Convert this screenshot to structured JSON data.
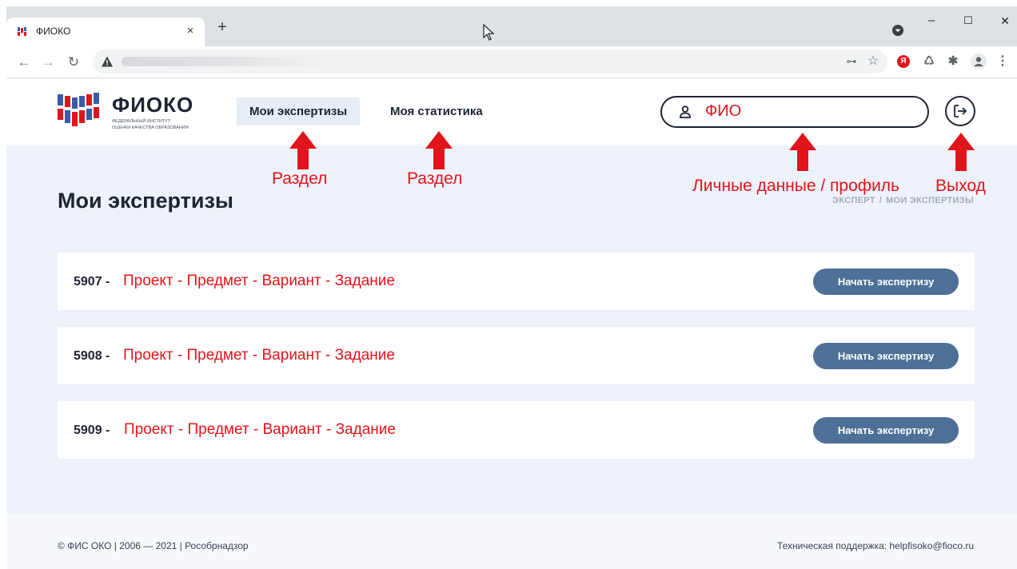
{
  "browser": {
    "tab_title": "ФИОКО",
    "tab_close": "×",
    "new_tab": "+",
    "minimize": "–",
    "maximize": "☐",
    "close": "✕",
    "back": "←",
    "forward": "→",
    "reload": "↻",
    "key_glyph": "⊶",
    "star_glyph": "☆",
    "ext_yandex": "Я",
    "ext_recycle": "♺",
    "ext_puzzle": "✱",
    "menu_glyph": "⋮"
  },
  "logo": {
    "title": "ФИОКО",
    "subtitle_line1": "Федеральный институт",
    "subtitle_line2": "оценки качества образования"
  },
  "nav": {
    "items": [
      {
        "label": "Мои экспертизы",
        "active": true
      },
      {
        "label": "Моя статистика",
        "active": false
      }
    ]
  },
  "profile": {
    "name": "ФИО"
  },
  "annotations": {
    "section_1": "Раздел",
    "section_2": "Раздел",
    "profile": "Личные данные / профиль",
    "logout": "Выход",
    "color": "#e2141b"
  },
  "page": {
    "title": "Мои экспертизы",
    "breadcrumb": [
      "Эксперт",
      "Мои экспертизы"
    ],
    "breadcrumb_sep": "/"
  },
  "expertises": [
    {
      "id": "5907 -",
      "name": "Проект - Предмет - Вариант - Задание",
      "button": "Начать экспертизу"
    },
    {
      "id": "5908 -",
      "name": "Проект - Предмет - Вариант - Задание",
      "button": "Начать экспертизу"
    },
    {
      "id": "5909 -",
      "name": "Проект - Предмет - Вариант - Задание",
      "button": "Начать экспертизу"
    }
  ],
  "footer": {
    "copyright": "© ФИС ОКО | 2006 — 2021 | Рособрнадзор",
    "support": "Техническая поддержка: helpfisoko@fioco.ru"
  },
  "colors": {
    "accent_button": "#4d7096",
    "page_bg": "#edf2fb",
    "active_tab_bg": "#e6edf7"
  }
}
